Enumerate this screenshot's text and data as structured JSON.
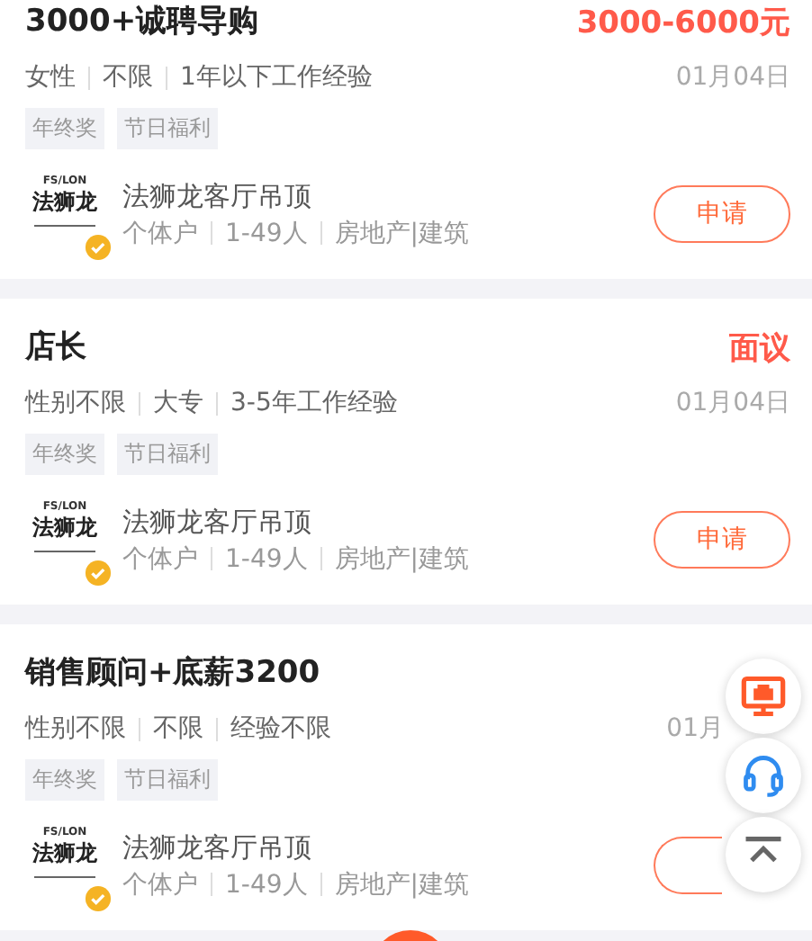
{
  "cards": [
    {
      "title": "3000+诚聘导购",
      "salary": "3000-6000元",
      "meta": [
        "女性",
        "不限",
        "1年以下工作经验"
      ],
      "date": "01月04日",
      "tags": [
        "年终奖",
        "节日福利"
      ],
      "company": {
        "logo_top": "FS/LON",
        "logo_main": "法狮龙",
        "verified": true,
        "name": "法狮龙客厅吊顶",
        "info": [
          "个体户",
          "1-49人",
          "房地产|建筑"
        ]
      },
      "apply": "申请"
    },
    {
      "title": "店长",
      "salary": "面议",
      "meta": [
        "性别不限",
        "大专",
        "3-5年工作经验"
      ],
      "date": "01月04日",
      "tags": [
        "年终奖",
        "节日福利"
      ],
      "company": {
        "logo_top": "FS/LON",
        "logo_main": "法狮龙",
        "verified": true,
        "name": "法狮龙客厅吊顶",
        "info": [
          "个体户",
          "1-49人",
          "房地产|建筑"
        ]
      },
      "apply": "申请"
    },
    {
      "title": "销售顾问+底薪3200",
      "meta": [
        "性别不限",
        "不限",
        "经验不限"
      ],
      "date": "01月",
      "tags": [
        "年终奖",
        "节日福利"
      ],
      "company": {
        "logo_top": "FS/LON",
        "logo_main": "法狮龙",
        "verified": true,
        "name": "法狮龙客厅吊顶",
        "info": [
          "个体户",
          "1-49人",
          "房地产|建筑"
        ]
      }
    }
  ],
  "floating_buttons": [
    {
      "kind": "monitor"
    },
    {
      "kind": "headset"
    },
    {
      "kind": "top"
    }
  ],
  "bottom_button": {
    "kind": "fab"
  }
}
